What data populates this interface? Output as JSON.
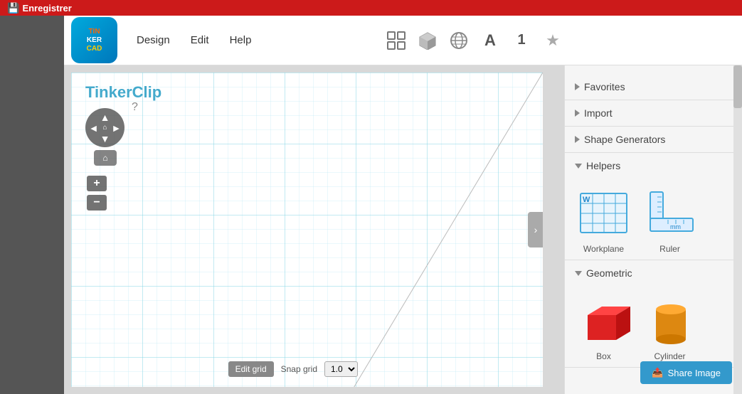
{
  "topbar": {
    "save_label": "Enregistrer"
  },
  "header": {
    "logo_lines": [
      "TIN",
      "KER",
      "CAD"
    ],
    "nav": [
      "Design",
      "Edit",
      "Help"
    ],
    "toolbar_icons": [
      "grid-icon",
      "cube-icon",
      "globe-icon",
      "text-A-icon",
      "number-1-icon",
      "star-icon"
    ]
  },
  "right_panel": {
    "sections": [
      {
        "id": "favorites",
        "label": "Favorites",
        "collapsed": true
      },
      {
        "id": "import",
        "label": "Import",
        "collapsed": true
      },
      {
        "id": "shape-generators",
        "label": "Shape Generators",
        "collapsed": true
      },
      {
        "id": "helpers",
        "label": "Helpers",
        "collapsed": false
      },
      {
        "id": "geometric",
        "label": "Geometric",
        "collapsed": false
      }
    ],
    "helpers": [
      {
        "id": "workplane",
        "label": "Workplane"
      },
      {
        "id": "ruler",
        "label": "Ruler"
      }
    ],
    "geometric": [
      {
        "id": "box",
        "label": "Box"
      },
      {
        "id": "cylinder",
        "label": "Cylinder"
      }
    ]
  },
  "canvas": {
    "project_title": "TinkerClip"
  },
  "bottom": {
    "edit_grid_label": "Edit grid",
    "snap_grid_label": "Snap grid",
    "snap_value": "1.0"
  },
  "share": {
    "label": "Share Image"
  }
}
